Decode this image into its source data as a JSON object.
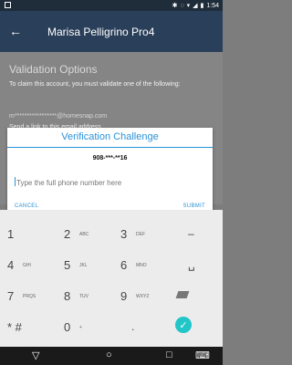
{
  "statusbar": {
    "time": "1:54",
    "icons": [
      "bluetooth-icon",
      "vibrate-icon",
      "wifi-icon",
      "signal-icon",
      "battery-icon"
    ]
  },
  "appbar": {
    "title": "Marisa Pelligrino Pro4",
    "back_label": "←"
  },
  "background": {
    "heading": "Validation Options",
    "instruction": "To claim this account, you must validate one of the following:",
    "email": "m*****************@homesnap.com",
    "send_link": "Send a link to this email address"
  },
  "dialog": {
    "title": "Verification Challenge",
    "masked_phone": "908-***-**16",
    "input_placeholder": "Type the full phone number here",
    "cancel_label": "CANCEL",
    "submit_label": "SUBMIT"
  },
  "keyboard": {
    "rows": [
      [
        {
          "main": "1",
          "sub": ""
        },
        {
          "main": "2",
          "sub": "ABC"
        },
        {
          "main": "3",
          "sub": "DEF"
        },
        {
          "main": "–",
          "sub": ""
        }
      ],
      [
        {
          "main": "4",
          "sub": "GHI"
        },
        {
          "main": "5",
          "sub": "JKL"
        },
        {
          "main": "6",
          "sub": "MNO"
        },
        {
          "main": "␣",
          "sub": ""
        }
      ],
      [
        {
          "main": "7",
          "sub": "PRQS"
        },
        {
          "main": "8",
          "sub": "TUV"
        },
        {
          "main": "9",
          "sub": "WXYZ"
        },
        {
          "main": "",
          "sub": ""
        }
      ],
      [
        {
          "main": "* #",
          "sub": ""
        },
        {
          "main": "0",
          "sub": "+"
        },
        {
          "main": ".",
          "sub": ""
        },
        {
          "main": "✓",
          "sub": ""
        }
      ]
    ]
  },
  "navbar": {
    "icons": [
      "back-triangle-icon",
      "home-circle-icon",
      "recent-square-icon",
      "keyboard-icon"
    ]
  }
}
